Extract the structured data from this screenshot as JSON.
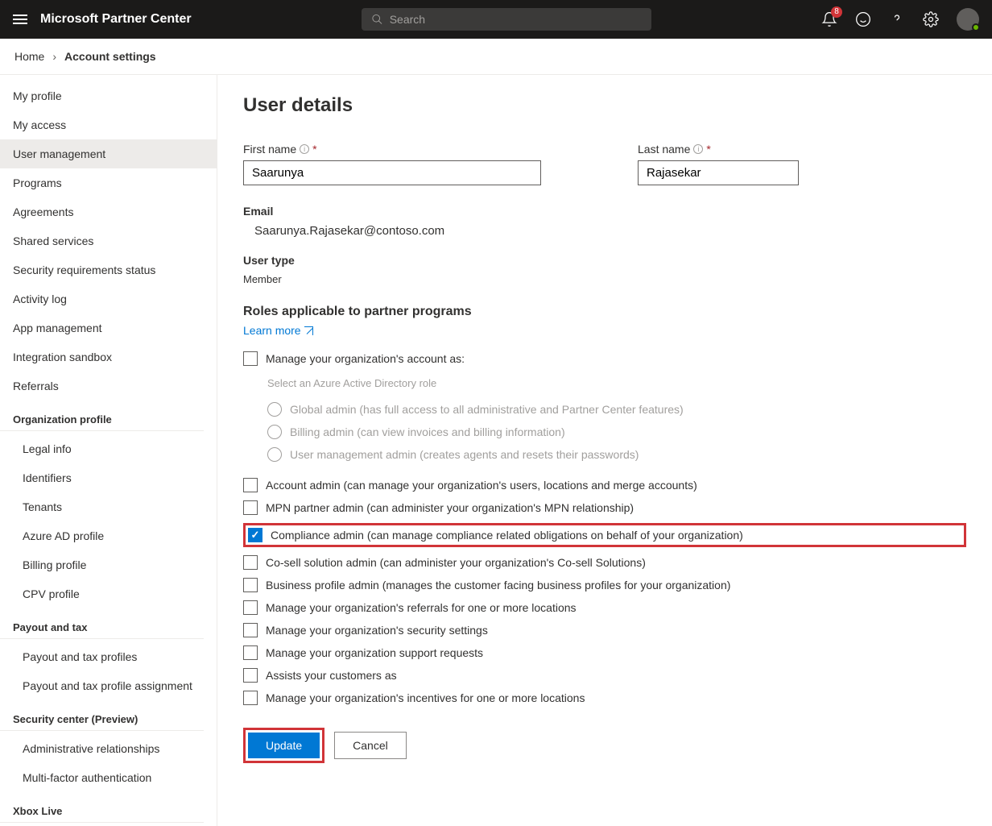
{
  "header": {
    "app_title": "Microsoft Partner Center",
    "search_placeholder": "Search",
    "notification_count": "8"
  },
  "breadcrumb": {
    "home": "Home",
    "current": "Account settings"
  },
  "sidebar": {
    "items": [
      {
        "label": "My profile",
        "active": false
      },
      {
        "label": "My access",
        "active": false
      },
      {
        "label": "User management",
        "active": true
      },
      {
        "label": "Programs",
        "active": false
      },
      {
        "label": "Agreements",
        "active": false
      },
      {
        "label": "Shared services",
        "active": false
      },
      {
        "label": "Security requirements status",
        "active": false
      },
      {
        "label": "Activity log",
        "active": false
      },
      {
        "label": "App management",
        "active": false
      },
      {
        "label": "Integration sandbox",
        "active": false
      },
      {
        "label": "Referrals",
        "active": false
      }
    ],
    "groups": [
      {
        "header": "Organization profile",
        "items": [
          "Legal info",
          "Identifiers",
          "Tenants",
          "Azure AD profile",
          "Billing profile",
          "CPV profile"
        ]
      },
      {
        "header": "Payout and tax",
        "items": [
          "Payout and tax profiles",
          "Payout and tax profile assignment"
        ]
      },
      {
        "header": "Security center (Preview)",
        "items": [
          "Administrative relationships",
          "Multi-factor authentication"
        ]
      },
      {
        "header": "Xbox Live",
        "items": []
      }
    ]
  },
  "content": {
    "page_title": "User details",
    "first_name_label": "First name",
    "last_name_label": "Last name",
    "first_name_value": "Saarunya",
    "last_name_value": "Rajasekar",
    "email_label": "Email",
    "email_value": "Saarunya.Rajasekar@contoso.com",
    "user_type_label": "User type",
    "user_type_value": "Member",
    "roles_section_title": "Roles applicable to partner programs",
    "learn_more": "Learn more",
    "manage_org_label": "Manage your organization's account as:",
    "ad_role_hint": "Select an Azure Active Directory role",
    "ad_roles": [
      "Global admin (has full access to all administrative and Partner Center features)",
      "Billing admin (can view invoices and billing information)",
      "User management admin (creates agents and resets their passwords)"
    ],
    "roles": [
      {
        "label": "Account admin (can manage your organization's users, locations and merge accounts)",
        "checked": false,
        "highlight": false
      },
      {
        "label": "MPN partner admin (can administer your organization's MPN relationship)",
        "checked": false,
        "highlight": false
      },
      {
        "label": "Compliance admin (can manage compliance related obligations on behalf of your organization)",
        "checked": true,
        "highlight": true
      },
      {
        "label": "Co-sell solution admin (can administer your organization's Co-sell Solutions)",
        "checked": false,
        "highlight": false
      },
      {
        "label": "Business profile admin (manages the customer facing business profiles for your organization)",
        "checked": false,
        "highlight": false
      },
      {
        "label": "Manage your organization's referrals for one or more locations",
        "checked": false,
        "highlight": false
      },
      {
        "label": "Manage your organization's security settings",
        "checked": false,
        "highlight": false
      },
      {
        "label": "Manage your organization support requests",
        "checked": false,
        "highlight": false
      },
      {
        "label": "Assists your customers as",
        "checked": false,
        "highlight": false
      },
      {
        "label": "Manage your organization's incentives for one or more locations",
        "checked": false,
        "highlight": false
      }
    ],
    "update_btn": "Update",
    "cancel_btn": "Cancel"
  }
}
